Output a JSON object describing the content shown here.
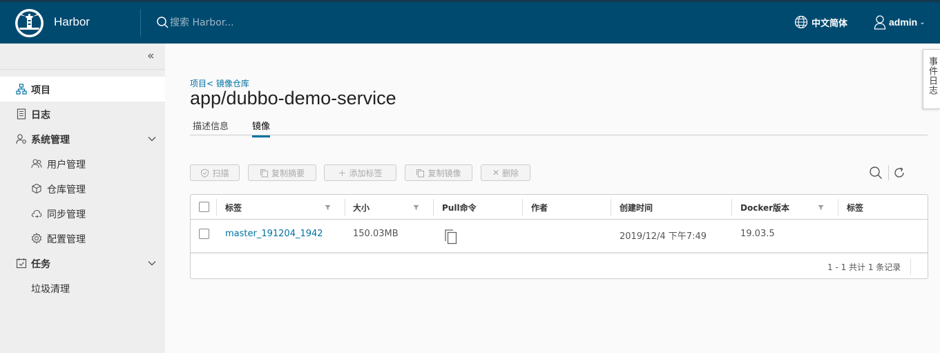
{
  "header": {
    "brand": "Harbor",
    "search_placeholder": "搜索 Harbor...",
    "language": "中文简体",
    "user": "admin"
  },
  "sidebar": {
    "items": [
      {
        "label": "项目",
        "icon": "projects-icon"
      },
      {
        "label": "日志",
        "icon": "logs-icon"
      },
      {
        "label": "系统管理",
        "icon": "admin-icon"
      },
      {
        "label": "用户管理",
        "icon": "users-icon"
      },
      {
        "label": "仓库管理",
        "icon": "registry-icon"
      },
      {
        "label": "同步管理",
        "icon": "replication-icon"
      },
      {
        "label": "配置管理",
        "icon": "config-icon"
      },
      {
        "label": "任务",
        "icon": "tasks-icon"
      },
      {
        "label": "垃圾清理",
        "icon": ""
      }
    ]
  },
  "main": {
    "breadcrumb": "项目< 镜像仓库",
    "title": "app/dubbo-demo-service",
    "tabs": [
      "描述信息",
      "镜像"
    ],
    "toolbar": [
      "扫描",
      "复制摘要",
      "添加标签",
      "复制镜像",
      "删除"
    ]
  },
  "table": {
    "columns": [
      "标签",
      "大小",
      "Pull命令",
      "作者",
      "创建时间",
      "Docker版本",
      "标签"
    ],
    "rows": [
      {
        "tag": "master_191204_1942",
        "size": "150.03MB",
        "author": "",
        "created": "2019/12/4 下午7:49",
        "docker_version": "19.03.5",
        "labels": ""
      }
    ],
    "footer": "1 - 1 共计 1 条记录"
  },
  "event_log": "事件日志",
  "colors": {
    "header": "#004a70",
    "accent": "#0072a3",
    "sidebar": "#eeeeee"
  }
}
